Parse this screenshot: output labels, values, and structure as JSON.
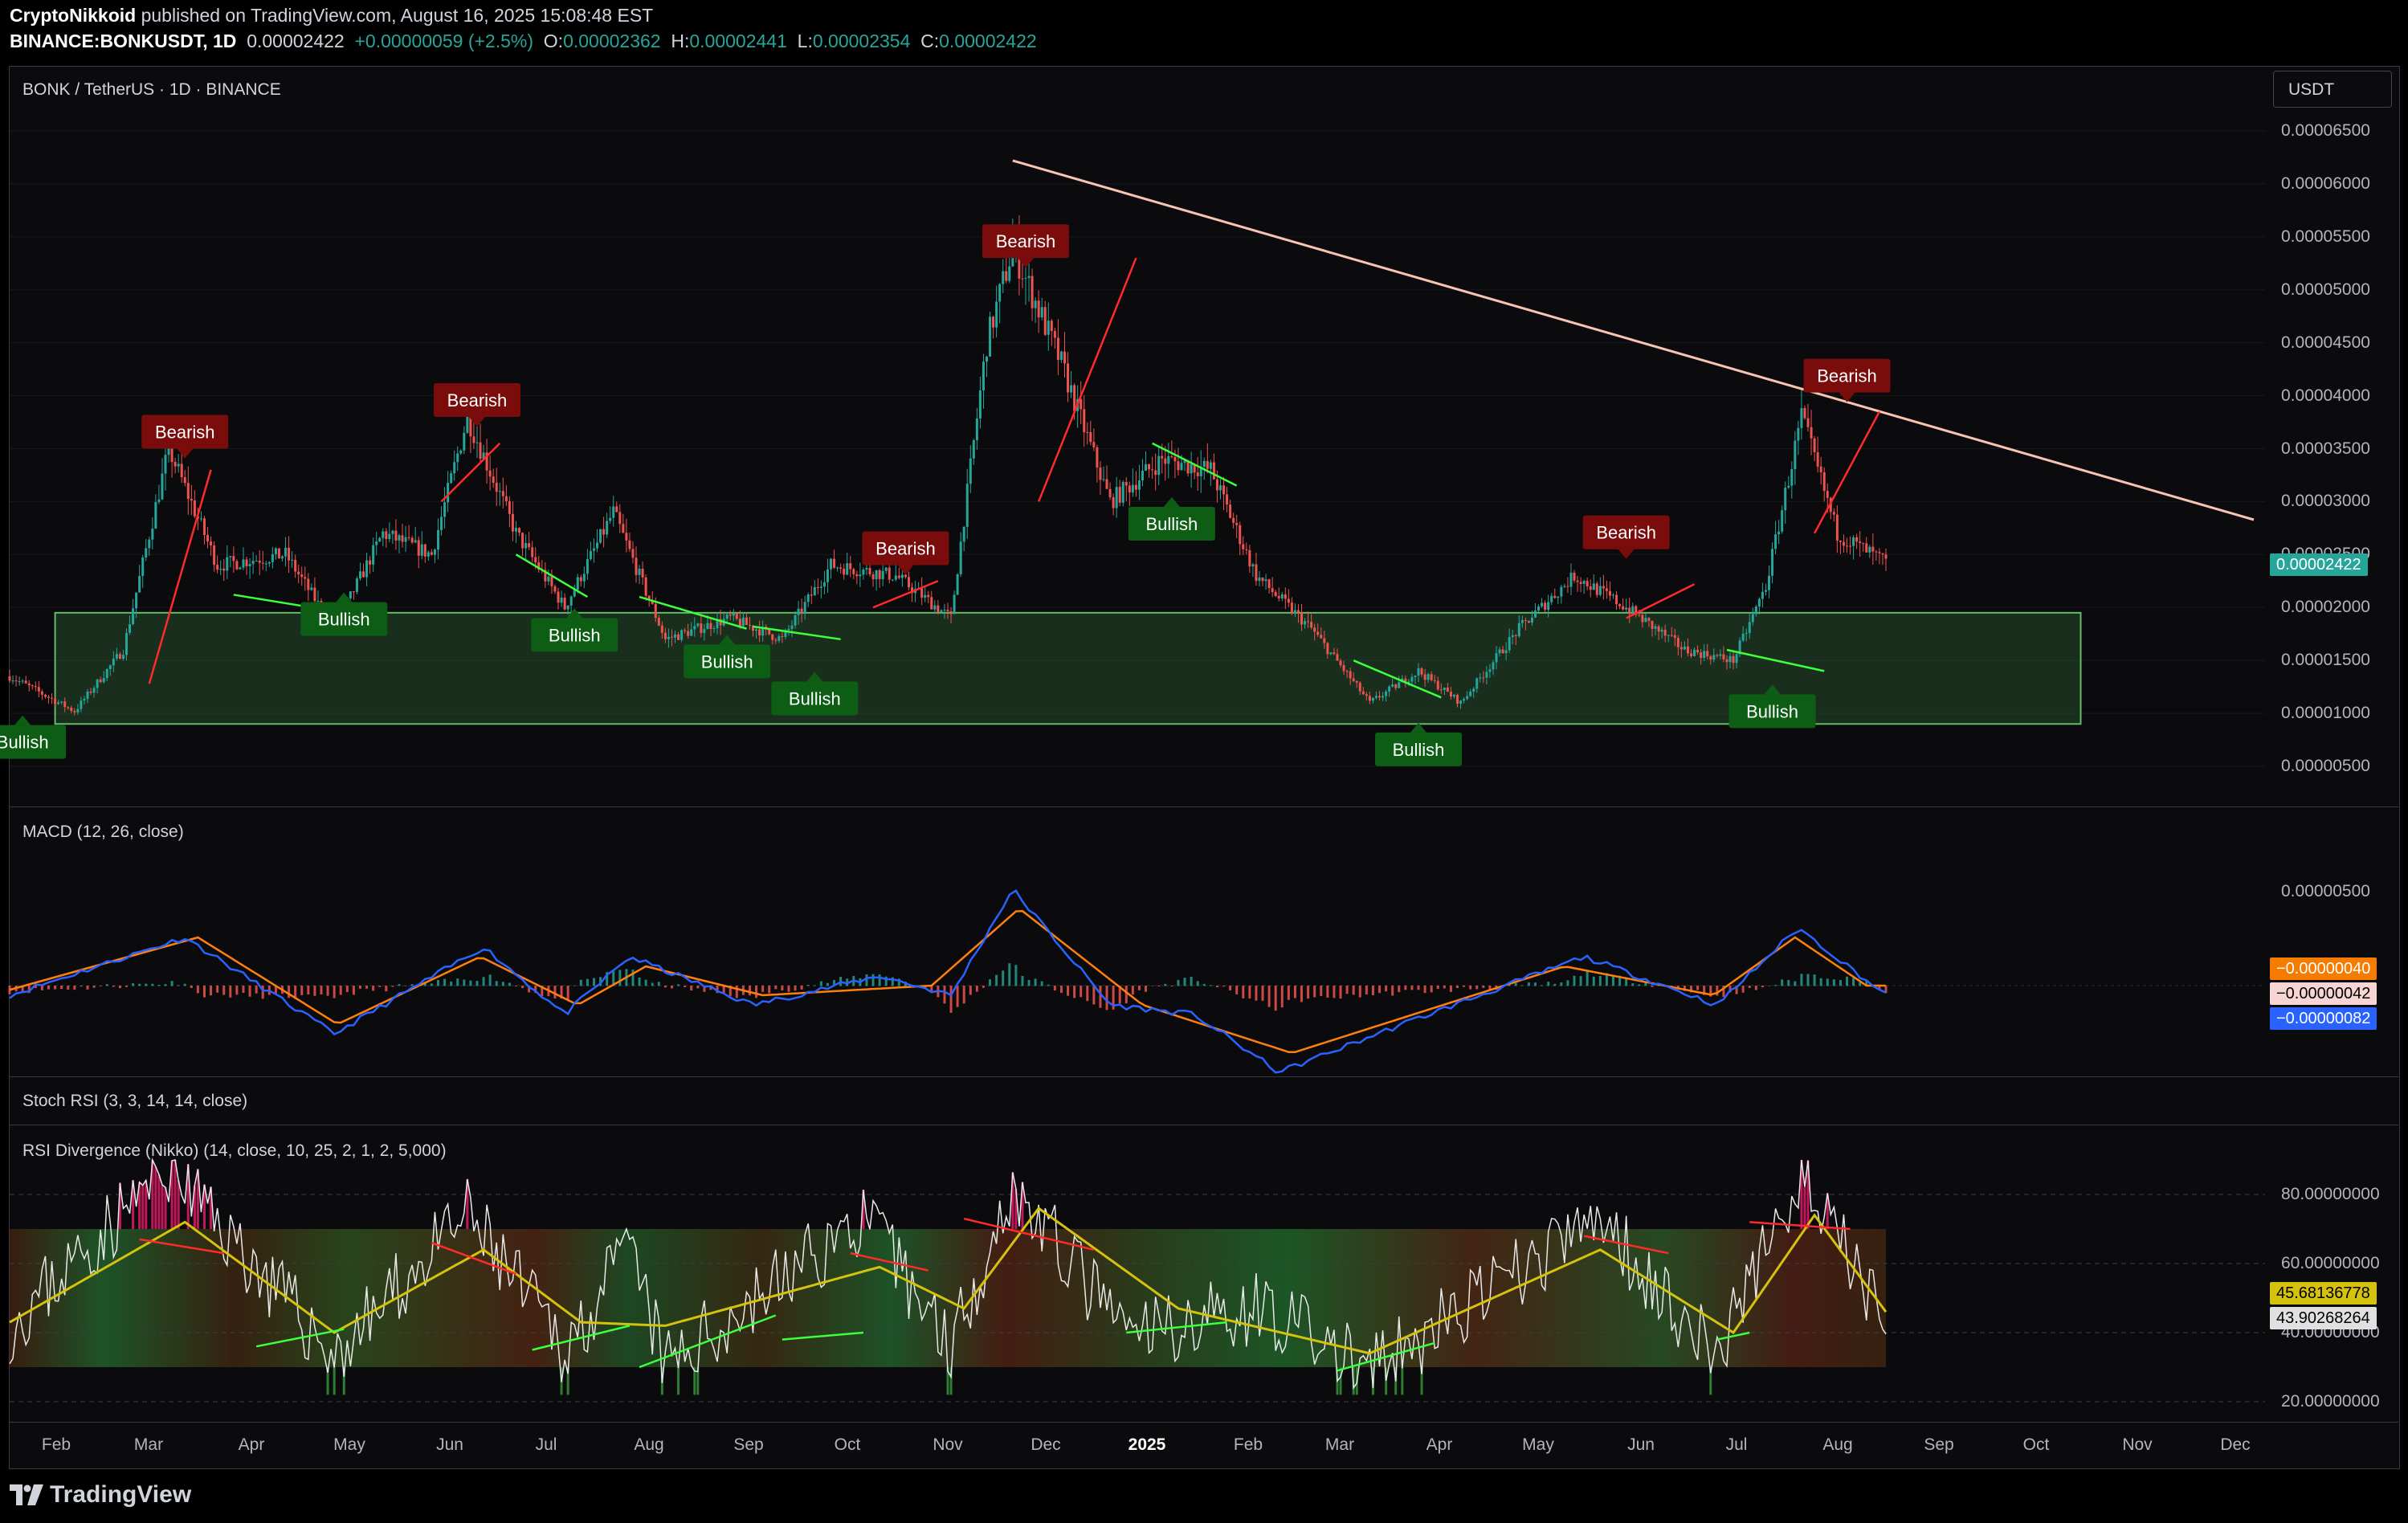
{
  "header": {
    "author": "CryptoNikkoid",
    "published": "published on TradingView.com, August 16, 2025 15:08:48 EST",
    "symbol": "BINANCE:BONKUSDT, 1D",
    "last": "0.00002422",
    "change": "+0.00000059 (+2.5%)",
    "o_label": "O:",
    "o": "0.00002362",
    "h_label": "H:",
    "h": "0.00002441",
    "l_label": "L:",
    "l": "0.00002354",
    "c_label": "C:",
    "c": "0.00002422"
  },
  "main_pane": {
    "title": "BONK / TetherUS · 1D · BINANCE",
    "currency_button": "USDT",
    "current_price": "0.00002422",
    "y_ticks": [
      "0.00006500",
      "0.00006000",
      "0.00005500",
      "0.00005000",
      "0.00004500",
      "0.00004000",
      "0.00003500",
      "0.00003000",
      "0.00002500",
      "0.00002000",
      "0.00001500",
      "0.00001000",
      "0.00000500"
    ]
  },
  "macd_pane": {
    "title": "MACD (12, 26, close)",
    "y_ticks": [
      "0.00000500"
    ],
    "values": [
      "−0.00000040",
      "−0.00000042",
      "−0.00000082"
    ]
  },
  "stoch_pane": {
    "title": "Stoch RSI (3, 3, 14, 14, close)"
  },
  "rsi_pane": {
    "title": "RSI Divergence (Nikko) (14, close, 10, 25, 2, 1, 2, 5,000)",
    "y_ticks": [
      "80.00000000",
      "60.00000000",
      "40.00000000",
      "20.00000000"
    ],
    "values": [
      "45.68136778",
      "43.90268264"
    ]
  },
  "x_axis": [
    "Feb",
    "Mar",
    "Apr",
    "May",
    "Jun",
    "Jul",
    "Aug",
    "Sep",
    "Oct",
    "Nov",
    "Dec",
    "2025",
    "Feb",
    "Mar",
    "Apr",
    "May",
    "Jun",
    "Jul",
    "Aug",
    "Sep",
    "Oct",
    "Nov",
    "Dec"
  ],
  "footer": {
    "brand": "TradingView"
  },
  "colors": {
    "up": "#26a69a",
    "down": "#ef5350",
    "bearish_label": "#7a0c0c",
    "bullish_label": "#0d5e14",
    "signal": "#ff7f0e",
    "macd": "#2962ff",
    "rsi_ma": "#d4c20d"
  },
  "chart_data": {
    "type": "candlestick",
    "x_range": [
      "2024-01-16",
      "2025-08-16"
    ],
    "ylim": [
      3.5e-06,
      6.8e-06
    ],
    "close_series": [
      {
        "date": "2024-01-16",
        "value": 1.35e-05
      },
      {
        "date": "2024-02-05",
        "value": 1.02e-05
      },
      {
        "date": "2024-02-20",
        "value": 1.6e-05
      },
      {
        "date": "2024-03-05",
        "value": 3.5e-05
      },
      {
        "date": "2024-03-20",
        "value": 2.4e-05
      },
      {
        "date": "2024-04-10",
        "value": 2.5e-05
      },
      {
        "date": "2024-04-25",
        "value": 1.8e-05
      },
      {
        "date": "2024-05-10",
        "value": 2.7e-05
      },
      {
        "date": "2024-05-25",
        "value": 2.5e-05
      },
      {
        "date": "2024-06-05",
        "value": 3.8e-05
      },
      {
        "date": "2024-06-20",
        "value": 2.7e-05
      },
      {
        "date": "2024-07-05",
        "value": 2e-05
      },
      {
        "date": "2024-07-20",
        "value": 2.9e-05
      },
      {
        "date": "2024-08-05",
        "value": 1.7e-05
      },
      {
        "date": "2024-08-25",
        "value": 1.9e-05
      },
      {
        "date": "2024-09-10",
        "value": 1.7e-05
      },
      {
        "date": "2024-09-25",
        "value": 2.4e-05
      },
      {
        "date": "2024-10-15",
        "value": 2.3e-05
      },
      {
        "date": "2024-11-01",
        "value": 1.9e-05
      },
      {
        "date": "2024-11-12",
        "value": 4.5e-05
      },
      {
        "date": "2024-11-20",
        "value": 5.4e-05
      },
      {
        "date": "2024-12-05",
        "value": 4.3e-05
      },
      {
        "date": "2024-12-20",
        "value": 3e-05
      },
      {
        "date": "2025-01-05",
        "value": 3.4e-05
      },
      {
        "date": "2025-01-20",
        "value": 3.3e-05
      },
      {
        "date": "2025-02-03",
        "value": 2.3e-05
      },
      {
        "date": "2025-02-20",
        "value": 1.8e-05
      },
      {
        "date": "2025-03-10",
        "value": 1.1e-05
      },
      {
        "date": "2025-03-25",
        "value": 1.4e-05
      },
      {
        "date": "2025-04-07",
        "value": 1.1e-05
      },
      {
        "date": "2025-04-25",
        "value": 1.8e-05
      },
      {
        "date": "2025-05-12",
        "value": 2.3e-05
      },
      {
        "date": "2025-05-28",
        "value": 2e-05
      },
      {
        "date": "2025-06-15",
        "value": 1.6e-05
      },
      {
        "date": "2025-06-30",
        "value": 1.5e-05
      },
      {
        "date": "2025-07-10",
        "value": 2.2e-05
      },
      {
        "date": "2025-07-21",
        "value": 3.8e-05
      },
      {
        "date": "2025-08-01",
        "value": 2.7e-05
      },
      {
        "date": "2025-08-16",
        "value": 2.422e-05
      }
    ],
    "support_zone": [
      9e-06,
      1.95e-05
    ],
    "trendline": [
      {
        "date": "2024-11-20",
        "value": 6.22e-05
      },
      {
        "date": "2025-12-20",
        "value": 2.83e-05
      }
    ],
    "signals": [
      {
        "label": "Bullish",
        "type": "bull",
        "date": "2024-01-20",
        "value": 8.9e-06
      },
      {
        "label": "Bearish",
        "type": "bear",
        "date": "2024-03-10",
        "value": 3.5e-05
      },
      {
        "label": "Bullish",
        "type": "bull",
        "date": "2024-04-28",
        "value": 2.05e-05
      },
      {
        "label": "Bearish",
        "type": "bear",
        "date": "2024-06-08",
        "value": 3.8e-05
      },
      {
        "label": "Bullish",
        "type": "bull",
        "date": "2024-07-08",
        "value": 1.9e-05
      },
      {
        "label": "Bullish",
        "type": "bull",
        "date": "2024-08-24",
        "value": 1.65e-05
      },
      {
        "label": "Bullish",
        "type": "bull",
        "date": "2024-09-20",
        "value": 1.3e-05
      },
      {
        "label": "Bearish",
        "type": "bear",
        "date": "2024-10-18",
        "value": 2.4e-05
      },
      {
        "label": "Bearish",
        "type": "bear",
        "date": "2024-11-24",
        "value": 5.3e-05
      },
      {
        "label": "Bullish",
        "type": "bull",
        "date": "2025-01-08",
        "value": 2.95e-05
      },
      {
        "label": "Bullish",
        "type": "bull",
        "date": "2025-03-25",
        "value": 8.2e-06
      },
      {
        "label": "Bearish",
        "type": "bear",
        "date": "2025-05-28",
        "value": 2.55e-05
      },
      {
        "label": "Bullish",
        "type": "bull",
        "date": "2025-07-12",
        "value": 1.18e-05
      },
      {
        "label": "Bearish",
        "type": "bear",
        "date": "2025-08-04",
        "value": 4.03e-05
      }
    ],
    "divergence_lines": [
      {
        "color": "red",
        "from": {
          "date": "2024-02-28",
          "value": 1.28e-05
        },
        "to": {
          "date": "2024-03-18",
          "value": 3.3e-05
        }
      },
      {
        "color": "green",
        "from": {
          "date": "2024-03-25",
          "value": 2.12e-05
        },
        "to": {
          "date": "2024-04-28",
          "value": 1.95e-05
        }
      },
      {
        "color": "red",
        "from": {
          "date": "2024-05-28",
          "value": 3e-05
        },
        "to": {
          "date": "2024-06-15",
          "value": 3.55e-05
        }
      },
      {
        "color": "green",
        "from": {
          "date": "2024-06-20",
          "value": 2.5e-05
        },
        "to": {
          "date": "2024-07-12",
          "value": 2.1e-05
        }
      },
      {
        "color": "green",
        "from": {
          "date": "2024-07-28",
          "value": 2.1e-05
        },
        "to": {
          "date": "2024-08-30",
          "value": 1.8e-05
        }
      },
      {
        "color": "green",
        "from": {
          "date": "2024-09-01",
          "value": 1.82e-05
        },
        "to": {
          "date": "2024-09-28",
          "value": 1.7e-05
        }
      },
      {
        "color": "red",
        "from": {
          "date": "2024-10-08",
          "value": 2e-05
        },
        "to": {
          "date": "2024-10-28",
          "value": 2.25e-05
        }
      },
      {
        "color": "red",
        "from": {
          "date": "2024-11-28",
          "value": 3e-05
        },
        "to": {
          "date": "2024-12-28",
          "value": 5.3e-05
        }
      },
      {
        "color": "green",
        "from": {
          "date": "2025-01-02",
          "value": 3.55e-05
        },
        "to": {
          "date": "2025-01-28",
          "value": 3.15e-05
        }
      },
      {
        "color": "green",
        "from": {
          "date": "2025-03-05",
          "value": 1.5e-05
        },
        "to": {
          "date": "2025-04-01",
          "value": 1.15e-05
        }
      },
      {
        "color": "red",
        "from": {
          "date": "2025-05-28",
          "value": 1.9e-05
        },
        "to": {
          "date": "2025-06-18",
          "value": 2.22e-05
        }
      },
      {
        "color": "green",
        "from": {
          "date": "2025-06-28",
          "value": 1.6e-05
        },
        "to": {
          "date": "2025-07-28",
          "value": 1.4e-05
        }
      },
      {
        "color": "red",
        "from": {
          "date": "2025-07-25",
          "value": 2.7e-05
        },
        "to": {
          "date": "2025-08-14",
          "value": 3.85e-05
        }
      }
    ],
    "macd_series": {
      "macd": [
        {
          "date": "2024-01-16",
          "value": -1e-07
        },
        {
          "date": "2024-03-10",
          "value": 5e-07
        },
        {
          "date": "2024-04-25",
          "value": -5e-07
        },
        {
          "date": "2024-06-10",
          "value": 4e-07
        },
        {
          "date": "2024-07-05",
          "value": -3e-07
        },
        {
          "date": "2024-07-25",
          "value": 3e-07
        },
        {
          "date": "2024-09-01",
          "value": -2e-07
        },
        {
          "date": "2024-10-10",
          "value": 1e-07
        },
        {
          "date": "2024-11-01",
          "value": -1e-07
        },
        {
          "date": "2024-11-20",
          "value": 1e-06
        },
        {
          "date": "2024-12-20",
          "value": -2e-07
        },
        {
          "date": "2025-01-15",
          "value": -3e-07
        },
        {
          "date": "2025-02-10",
          "value": -9e-07
        },
        {
          "date": "2025-03-20",
          "value": -4e-07
        },
        {
          "date": "2025-05-15",
          "value": 3e-07
        },
        {
          "date": "2025-06-25",
          "value": -2e-07
        },
        {
          "date": "2025-07-20",
          "value": 6e-07
        },
        {
          "date": "2025-08-16",
          "value": -1e-07
        }
      ],
      "signal": [
        {
          "date": "2024-01-16",
          "value": -1e-07
        },
        {
          "date": "2024-03-20",
          "value": 5e-07
        },
        {
          "date": "2024-05-02",
          "value": -4e-07
        },
        {
          "date": "2024-06-15",
          "value": 3e-07
        },
        {
          "date": "2024-07-15",
          "value": -2e-07
        },
        {
          "date": "2024-08-05",
          "value": 2e-07
        },
        {
          "date": "2024-09-10",
          "value": -1e-07
        },
        {
          "date": "2024-11-01",
          "value": 0.0
        },
        {
          "date": "2024-11-28",
          "value": 8e-07
        },
        {
          "date": "2025-01-05",
          "value": -2e-07
        },
        {
          "date": "2025-02-20",
          "value": -7e-07
        },
        {
          "date": "2025-05-15",
          "value": 2e-07
        },
        {
          "date": "2025-06-30",
          "value": -1e-07
        },
        {
          "date": "2025-07-25",
          "value": 5e-07
        },
        {
          "date": "2025-08-16",
          "value": -0.0
        }
      ]
    },
    "rsi_series": {
      "rsi": [
        {
          "date": "2024-01-16",
          "value": 42
        },
        {
          "date": "2024-03-05",
          "value": 88
        },
        {
          "date": "2024-04-25",
          "value": 33
        },
        {
          "date": "2024-06-05",
          "value": 74
        },
        {
          "date": "2024-07-05",
          "value": 35
        },
        {
          "date": "2024-07-25",
          "value": 64
        },
        {
          "date": "2024-08-05",
          "value": 30
        },
        {
          "date": "2024-10-05",
          "value": 73
        },
        {
          "date": "2024-11-01",
          "value": 37
        },
        {
          "date": "2024-11-20",
          "value": 82
        },
        {
          "date": "2024-12-25",
          "value": 39
        },
        {
          "date": "2025-02-05",
          "value": 48
        },
        {
          "date": "2025-03-10",
          "value": 28
        },
        {
          "date": "2025-05-20",
          "value": 73
        },
        {
          "date": "2025-06-25",
          "value": 33
        },
        {
          "date": "2025-07-20",
          "value": 85
        },
        {
          "date": "2025-08-16",
          "value": 44
        }
      ],
      "ma": [
        {
          "date": "2024-01-16",
          "value": 43
        },
        {
          "date": "2024-03-10",
          "value": 72
        },
        {
          "date": "2024-04-25",
          "value": 40
        },
        {
          "date": "2024-06-10",
          "value": 64
        },
        {
          "date": "2024-07-10",
          "value": 43
        },
        {
          "date": "2024-08-05",
          "value": 42
        },
        {
          "date": "2024-10-10",
          "value": 59
        },
        {
          "date": "2024-11-05",
          "value": 47
        },
        {
          "date": "2024-11-28",
          "value": 76
        },
        {
          "date": "2025-01-10",
          "value": 47
        },
        {
          "date": "2025-03-10",
          "value": 34
        },
        {
          "date": "2025-05-20",
          "value": 64
        },
        {
          "date": "2025-06-30",
          "value": 40
        },
        {
          "date": "2025-07-25",
          "value": 74
        },
        {
          "date": "2025-08-16",
          "value": 46
        }
      ],
      "overbought": 80,
      "upper_band": 70,
      "lower_band": 30,
      "oversold": 20
    }
  }
}
